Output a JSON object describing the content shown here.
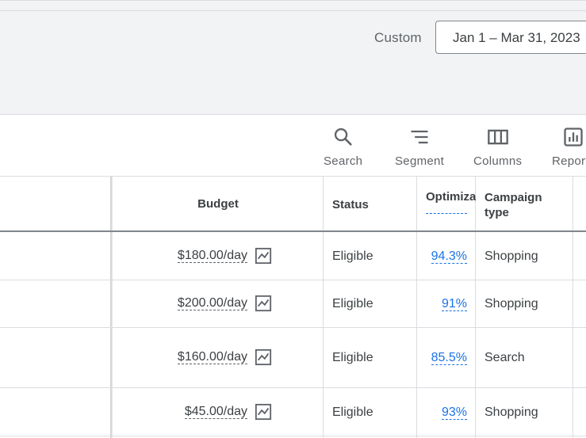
{
  "date_range": {
    "preset_label": "Custom",
    "value": "Jan 1 – Mar 31, 2023"
  },
  "toolbar": {
    "search_label": "Search",
    "segment_label": "Segment",
    "columns_label": "Columns",
    "reports_label": "Reports"
  },
  "table": {
    "headers": {
      "budget": "Budget",
      "status": "Status",
      "optimization": "Optimization score",
      "campaign_type_line1": "Campaign",
      "campaign_type_line2": "type"
    },
    "rows": [
      {
        "budget": "$180.00/day",
        "status": "Eligible",
        "optimization": "94.3%",
        "campaign_type": "Shopping"
      },
      {
        "budget": "$200.00/day",
        "status": "Eligible",
        "optimization": "91%",
        "campaign_type": "Shopping"
      },
      {
        "budget": "$160.00/day",
        "status": "Eligible",
        "optimization": "85.5%",
        "campaign_type": "Search"
      },
      {
        "budget": "$45.00/day",
        "status": "Eligible",
        "optimization": "93%",
        "campaign_type": "Shopping"
      }
    ]
  },
  "icons": {
    "search": "search-icon",
    "segment": "segment-icon",
    "columns": "columns-icon",
    "reports": "reports-icon",
    "budget_chart": "trend-chart-icon"
  },
  "colors": {
    "link": "#1a73e8",
    "text": "#3c4043",
    "muted": "#5f6368",
    "panel_bg": "#f1f3f4"
  }
}
